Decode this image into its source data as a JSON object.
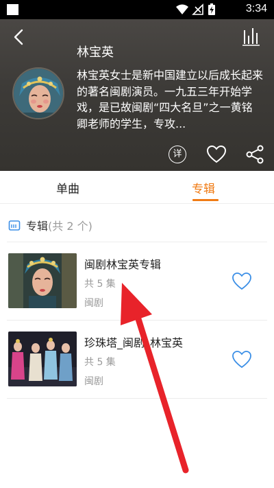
{
  "status_bar": {
    "time": "3:34"
  },
  "header": {
    "artist_name": "林宝英",
    "bio": "林宝英女士是新中国建立以后成长起来的著名闽剧演员。一九五三年开始学戏，是已故闽剧“四大名旦”之一黄铭卿老师的学生，专攻...",
    "detail_label": "详"
  },
  "tabs": {
    "single": "单曲",
    "album": "专辑",
    "active_color": "#f07b14"
  },
  "section": {
    "title": "专辑",
    "count": "(共 2 个)"
  },
  "albums": [
    {
      "title": "闽剧林宝英专辑",
      "count": "共 5 集",
      "genre": "闽剧"
    },
    {
      "title": "珍珠塔_闽剧_林宝英",
      "count": "共 5 集",
      "genre": "闽剧"
    }
  ],
  "colors": {
    "accent": "#f07b14",
    "heart_blue": "#3a8ee6",
    "annotation_arrow": "#e8232a"
  }
}
